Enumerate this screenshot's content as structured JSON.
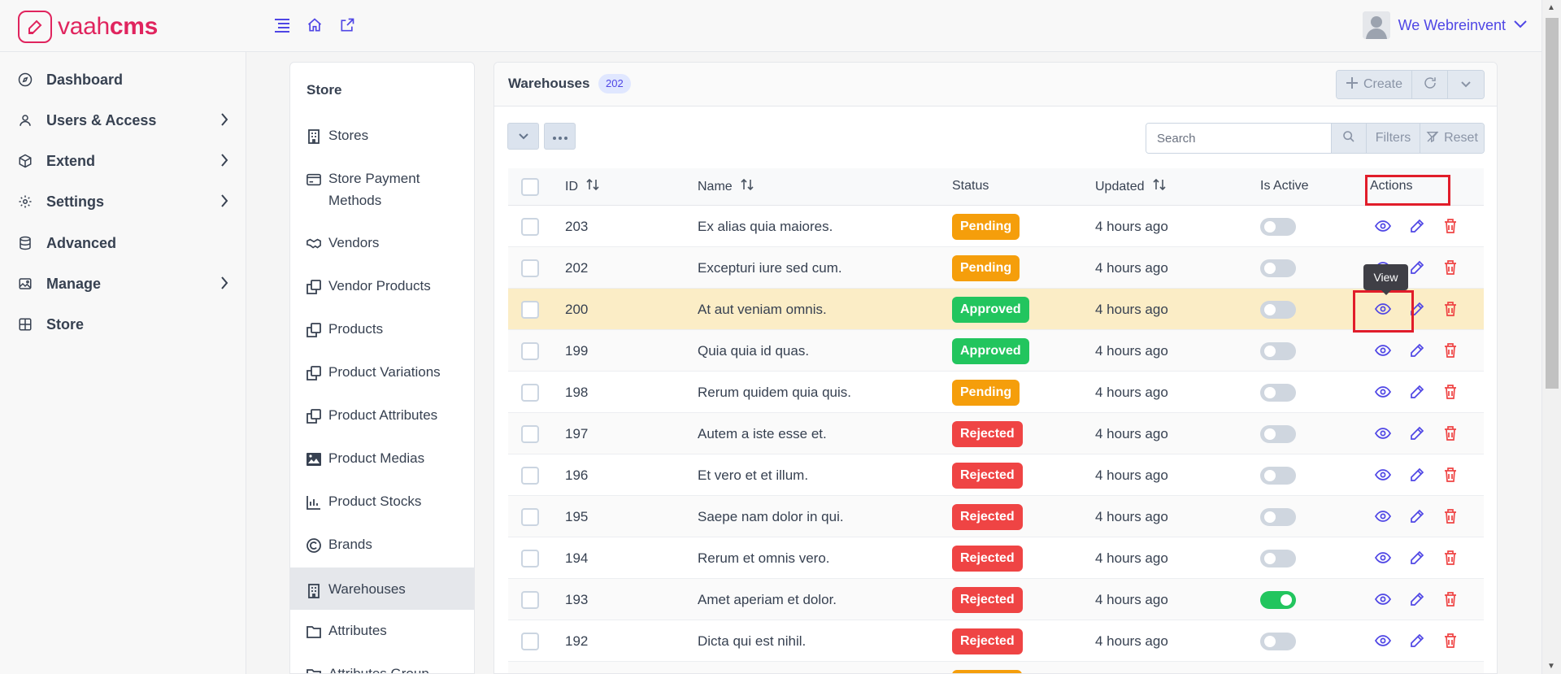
{
  "brand": {
    "name_light": "vaah",
    "name_bold": "cms"
  },
  "user": {
    "name": "We Webreinvent"
  },
  "sidebar": {
    "items": [
      {
        "label": "Dashboard",
        "icon": "compass-icon",
        "chevron": false
      },
      {
        "label": "Users & Access",
        "icon": "user-icon",
        "chevron": true
      },
      {
        "label": "Extend",
        "icon": "cube-icon",
        "chevron": true
      },
      {
        "label": "Settings",
        "icon": "cog-icon",
        "chevron": true
      },
      {
        "label": "Advanced",
        "icon": "database-icon",
        "chevron": false
      },
      {
        "label": "Manage",
        "icon": "image-icon",
        "chevron": true
      },
      {
        "label": "Store",
        "icon": "grid-icon",
        "chevron": false
      }
    ]
  },
  "store_menu": {
    "title": "Store",
    "items": [
      {
        "label": "Stores",
        "icon": "building-icon"
      },
      {
        "label": "Store Payment Methods",
        "icon": "card-icon"
      },
      {
        "label": "Vendors",
        "icon": "handshake-icon"
      },
      {
        "label": "Vendor Products",
        "icon": "clone-icon"
      },
      {
        "label": "Products",
        "icon": "clone-icon"
      },
      {
        "label": "Product Variations",
        "icon": "clone-icon"
      },
      {
        "label": "Product Attributes",
        "icon": "clone-icon"
      },
      {
        "label": "Product Medias",
        "icon": "picture-icon"
      },
      {
        "label": "Product Stocks",
        "icon": "chart-bar-icon"
      },
      {
        "label": "Brands",
        "icon": "copyright-icon"
      },
      {
        "label": "Warehouses",
        "icon": "building-icon",
        "active": true
      },
      {
        "label": "Attributes",
        "icon": "folder-icon"
      },
      {
        "label": "Attributes Group",
        "icon": "folder-icon"
      }
    ]
  },
  "warehouses": {
    "title": "Warehouses",
    "count": "202",
    "create_label": "Create",
    "search_placeholder": "Search",
    "filters_label": "Filters",
    "reset_label": "Reset",
    "columns": {
      "id": "ID",
      "name": "Name",
      "status": "Status",
      "updated": "Updated",
      "is_active": "Is Active",
      "actions": "Actions"
    },
    "tooltip": "View",
    "status_colors": {
      "Pending": "#f59e0b",
      "Approved": "#22c55e",
      "Rejected": "#ef4444"
    },
    "rows": [
      {
        "id": "203",
        "name": "Ex alias quia maiores.",
        "status": "Pending",
        "updated": "4 hours ago",
        "active": false
      },
      {
        "id": "202",
        "name": "Excepturi iure sed cum.",
        "status": "Pending",
        "updated": "4 hours ago",
        "active": false
      },
      {
        "id": "200",
        "name": "At aut veniam omnis.",
        "status": "Approved",
        "updated": "4 hours ago",
        "active": false
      },
      {
        "id": "199",
        "name": "Quia quia id quas.",
        "status": "Approved",
        "updated": "4 hours ago",
        "active": false
      },
      {
        "id": "198",
        "name": "Rerum quidem quia quis.",
        "status": "Pending",
        "updated": "4 hours ago",
        "active": false
      },
      {
        "id": "197",
        "name": "Autem a iste esse et.",
        "status": "Rejected",
        "updated": "4 hours ago",
        "active": false
      },
      {
        "id": "196",
        "name": "Et vero et et illum.",
        "status": "Rejected",
        "updated": "4 hours ago",
        "active": false
      },
      {
        "id": "195",
        "name": "Saepe nam dolor in qui.",
        "status": "Rejected",
        "updated": "4 hours ago",
        "active": false
      },
      {
        "id": "194",
        "name": "Rerum et omnis vero.",
        "status": "Rejected",
        "updated": "4 hours ago",
        "active": false
      },
      {
        "id": "193",
        "name": "Amet aperiam et dolor.",
        "status": "Rejected",
        "updated": "4 hours ago",
        "active": true
      },
      {
        "id": "192",
        "name": "Dicta qui est nihil.",
        "status": "Rejected",
        "updated": "4 hours ago",
        "active": false
      }
    ]
  }
}
